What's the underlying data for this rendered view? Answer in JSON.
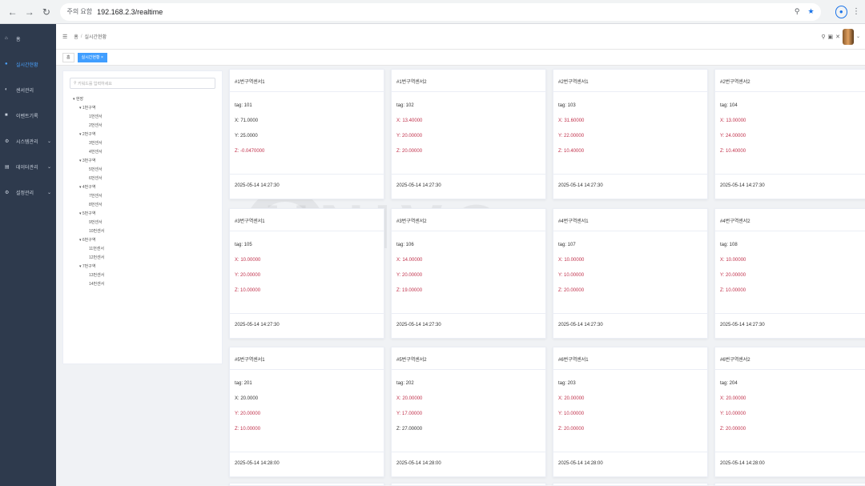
{
  "browser": {
    "security_label": "주의 요함",
    "url": "192.168.2.3/realtime"
  },
  "sidebar": {
    "items": [
      {
        "label": "홈",
        "active": false,
        "has_arrow": false
      },
      {
        "label": "실시간현황",
        "active": true,
        "has_arrow": false
      },
      {
        "label": "센서관리",
        "active": false,
        "has_arrow": false
      },
      {
        "label": "이벤트기록",
        "active": false,
        "has_arrow": false
      },
      {
        "label": "시스템관리",
        "active": false,
        "has_arrow": true
      },
      {
        "label": "데이터관리",
        "active": false,
        "has_arrow": true
      },
      {
        "label": "설정관리",
        "active": false,
        "has_arrow": true
      }
    ]
  },
  "header": {
    "breadcrumb_home": "홈",
    "breadcrumb_current": "실시간현황"
  },
  "tags": {
    "first": "홈",
    "active": "실시간현황"
  },
  "tree": {
    "search_placeholder": "키워드를 입력하세요",
    "nodes": [
      {
        "label": "현장",
        "level": 0
      },
      {
        "label": "1번구역",
        "level": 1
      },
      {
        "label": "1번센서",
        "level": 2
      },
      {
        "label": "2번센서",
        "level": 2
      },
      {
        "label": "2번구역",
        "level": 1
      },
      {
        "label": "3번센서",
        "level": 2
      },
      {
        "label": "4번센서",
        "level": 2
      },
      {
        "label": "3번구역",
        "level": 1
      },
      {
        "label": "5번센서",
        "level": 2
      },
      {
        "label": "6번센서",
        "level": 2
      },
      {
        "label": "4번구역",
        "level": 1
      },
      {
        "label": "7번센서",
        "level": 2
      },
      {
        "label": "8번센서",
        "level": 2
      },
      {
        "label": "5번구역",
        "level": 1
      },
      {
        "label": "9번센서",
        "level": 2
      },
      {
        "label": "10번센서",
        "level": 2
      },
      {
        "label": "6번구역",
        "level": 1
      },
      {
        "label": "11번센서",
        "level": 2
      },
      {
        "label": "12번센서",
        "level": 2
      },
      {
        "label": "7번구역",
        "level": 1
      },
      {
        "label": "13번센서",
        "level": 2
      },
      {
        "label": "14번센서",
        "level": 2
      }
    ]
  },
  "cards": [
    {
      "title": "#1번구역센서1",
      "tag": "tag: 101",
      "x": "X: 71.0000",
      "y": "Y: 25.0000",
      "z": "Z: -0.0470000",
      "red": [
        false,
        false,
        true
      ],
      "time": "2025-05-14 14:27:30"
    },
    {
      "title": "#1번구역센서2",
      "tag": "tag: 102",
      "x": "X: 13.40000",
      "y": "Y: 20.00000",
      "z": "Z: 20.00000",
      "red": [
        true,
        true,
        true
      ],
      "time": "2025-05-14 14:27:30"
    },
    {
      "title": "#2번구역센서1",
      "tag": "tag: 103",
      "x": "X: 31.60000",
      "y": "Y: 22.00000",
      "z": "Z: 10.40000",
      "red": [
        true,
        true,
        true
      ],
      "time": "2025-05-14 14:27:30"
    },
    {
      "title": "#2번구역센서2",
      "tag": "tag: 104",
      "x": "X: 13.00000",
      "y": "Y: 24.00000",
      "z": "Z: 10.40000",
      "red": [
        true,
        true,
        true
      ],
      "time": "2025-05-14 14:27:30"
    },
    {
      "title": "#3번구역센서1",
      "tag": "tag: 105",
      "x": "X: 10.00000",
      "y": "Y: 20.00000",
      "z": "Z: 10.00000",
      "red": [
        true,
        true,
        true
      ],
      "time": "2025-05-14 14:27:30"
    },
    {
      "title": "#3번구역센서2",
      "tag": "tag: 106",
      "x": "X: 14.00000",
      "y": "Y: 20.00000",
      "z": "Z: 19.00000",
      "red": [
        true,
        true,
        true
      ],
      "time": "2025-05-14 14:27:30"
    },
    {
      "title": "#4번구역센서1",
      "tag": "tag: 107",
      "x": "X: 10.00000",
      "y": "Y: 10.00000",
      "z": "Z: 20.00000",
      "red": [
        true,
        true,
        true
      ],
      "time": "2025-05-14 14:27:30"
    },
    {
      "title": "#4번구역센서2",
      "tag": "tag: 108",
      "x": "X: 10.00000",
      "y": "Y: 20.00000",
      "z": "Z: 10.00000",
      "red": [
        true,
        true,
        true
      ],
      "time": "2025-05-14 14:27:30"
    },
    {
      "title": "#5번구역센서1",
      "tag": "tag: 201",
      "x": "X: 20.0000",
      "y": "Y: 20.00000",
      "z": "Z: 10.00000",
      "red": [
        false,
        true,
        true
      ],
      "time": "2025-05-14 14:28:00"
    },
    {
      "title": "#5번구역센서2",
      "tag": "tag: 202",
      "x": "X: 20.00000",
      "y": "Y: 17.00000",
      "z": "Z: 27.00000",
      "red": [
        true,
        true,
        false
      ],
      "time": "2025-05-14 14:28:00"
    },
    {
      "title": "#6번구역센서1",
      "tag": "tag: 203",
      "x": "X: 20.00000",
      "y": "Y: 10.00000",
      "z": "Z: 20.00000",
      "red": [
        true,
        true,
        true
      ],
      "time": "2025-05-14 14:28:00"
    },
    {
      "title": "#6번구역센서2",
      "tag": "tag: 204",
      "x": "X: 20.00000",
      "y": "Y: 10.00000",
      "z": "Z: 20.00000",
      "red": [
        true,
        true,
        true
      ],
      "time": "2025-05-14 14:28:00"
    }
  ]
}
